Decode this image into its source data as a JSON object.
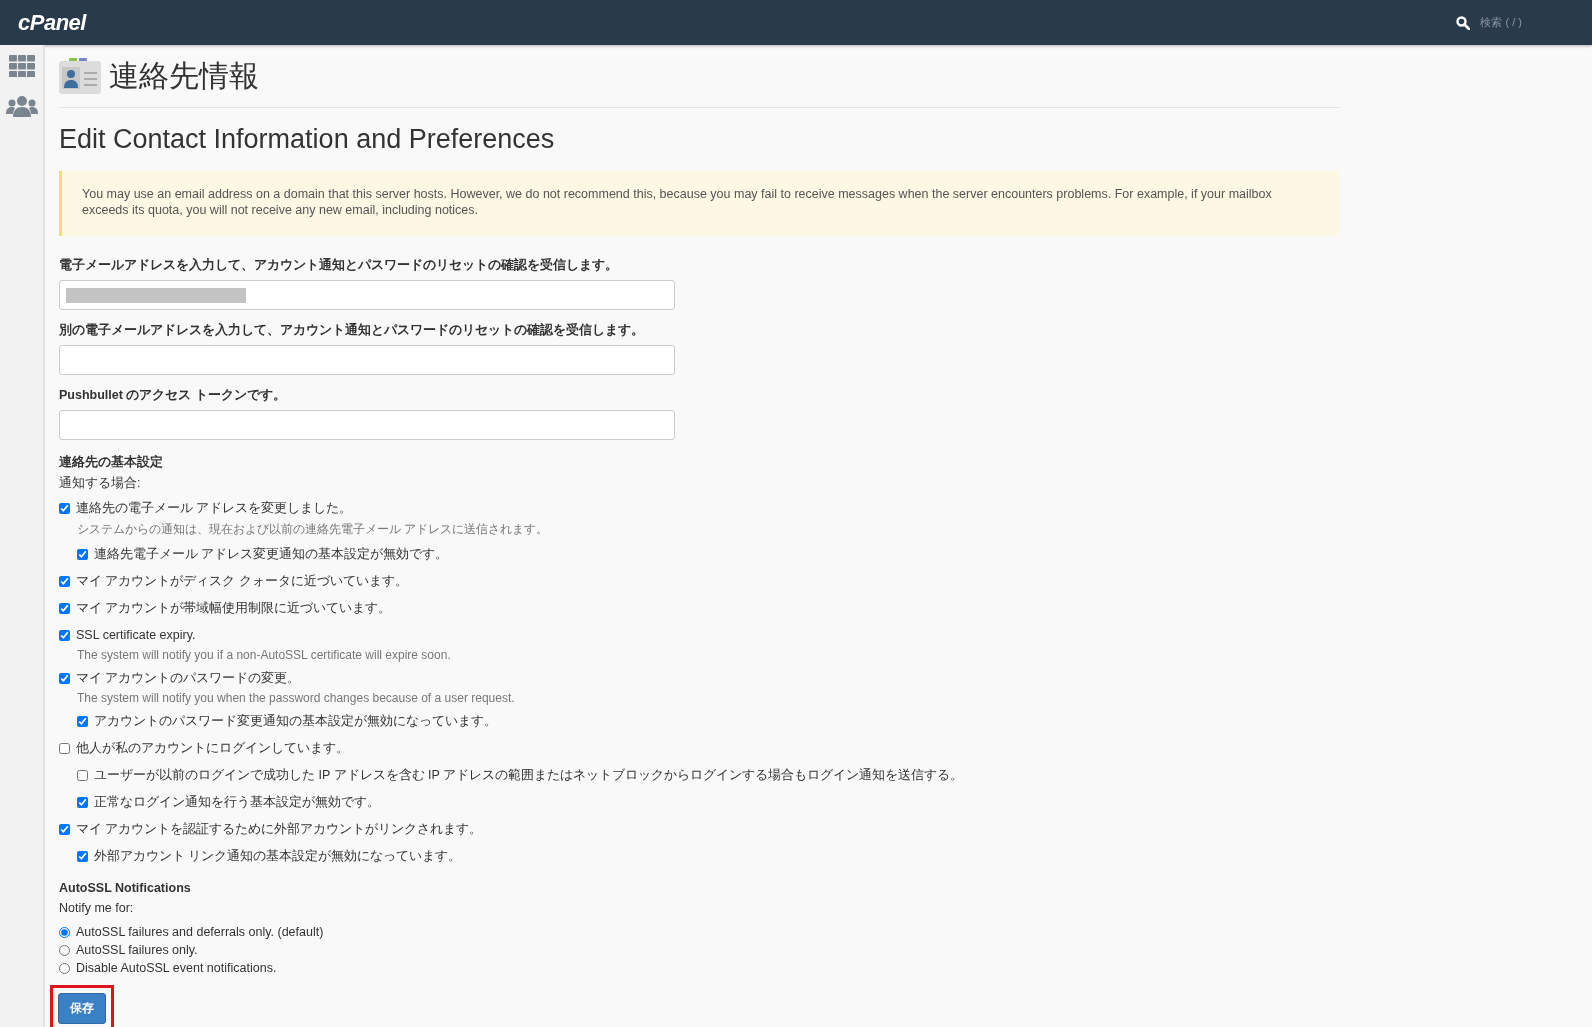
{
  "top_bar": {
    "logo": "cPanel",
    "search": {
      "placeholder": "検索 ( / )"
    }
  },
  "sidebar": {
    "items": [
      {
        "kind": "grid"
      },
      {
        "kind": "users"
      }
    ]
  },
  "page": {
    "title": "連絡先情報",
    "heading": "Edit Contact Information and Preferences",
    "alert": "You may use an email address on a domain that this server hosts. However, we do not recommend this, because you may fail to receive messages when the server encounters problems. For example, if your mailbox exceeds its quota, you will not receive any new email, including notices.",
    "fields": [
      {
        "label": "電子メールアドレスを入力して、アカウント通知とパスワードのリセットの確認を受信します。",
        "redacted": true
      },
      {
        "label": "別の電子メールアドレスを入力して、アカウント通知とパスワードのリセットの確認を受信します。",
        "redacted": false
      },
      {
        "label": "Pushbullet のアクセス トークンです。",
        "redacted": false
      }
    ],
    "preferences": {
      "title": "連絡先の基本設定",
      "subtitle": "通知する場合:",
      "items": [
        {
          "label": "連絡先の電子メール アドレスを変更しました。",
          "checked": true,
          "description": "システムからの通知は、現在および以前の連絡先電子メール アドレスに送信されます。",
          "children": [
            {
              "label": "連絡先電子メール アドレス変更通知の基本設定が無効です。",
              "checked": true
            }
          ]
        },
        {
          "label": "マイ アカウントがディスク クォータに近づいています。",
          "checked": true
        },
        {
          "label": "マイ アカウントが帯域幅使用制限に近づいています。",
          "checked": true
        },
        {
          "label": "SSL certificate expiry.",
          "checked": true,
          "description": "The system will notify you if a non-AutoSSL certificate will expire soon."
        },
        {
          "label": "マイ アカウントのパスワードの変更。",
          "checked": true,
          "description": "The system will notify you when the password changes because of a user request.",
          "children": [
            {
              "label": "アカウントのパスワード変更通知の基本設定が無効になっています。",
              "checked": true
            }
          ]
        },
        {
          "label": "他人が私のアカウントにログインしています。",
          "checked": false,
          "children": [
            {
              "label": "ユーザーが以前のログインで成功した IP アドレスを含む IP アドレスの範囲またはネットブロックからログインする場合もログイン通知を送信する。",
              "checked": false
            },
            {
              "label": "正常なログイン通知を行う基本設定が無効です。",
              "checked": true
            }
          ]
        },
        {
          "label": "マイ アカウントを認証するために外部アカウントがリンクされます。",
          "checked": true,
          "children": [
            {
              "label": "外部アカウント リンク通知の基本設定が無効になっています。",
              "checked": true
            }
          ]
        }
      ]
    },
    "autossl": {
      "title": "AutoSSL Notifications",
      "subtitle": "Notify me for:",
      "options": [
        {
          "label": "AutoSSL failures and deferrals only. (default)",
          "selected": true
        },
        {
          "label": "AutoSSL failures only.",
          "selected": false
        },
        {
          "label": "Disable AutoSSL event notifications.",
          "selected": false
        }
      ]
    },
    "save_button": {
      "label": "保存",
      "highlighted": true
    }
  }
}
